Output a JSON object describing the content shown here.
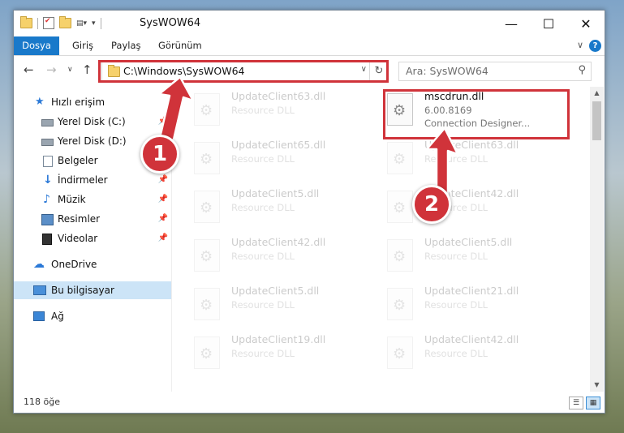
{
  "window": {
    "title": "SysWOW64"
  },
  "ribbon": {
    "tabs": [
      "Dosya",
      "Giriş",
      "Paylaş",
      "Görünüm"
    ]
  },
  "address": {
    "path": "C:\\Windows\\SysWOW64"
  },
  "search": {
    "placeholder": "Ara: SysWOW64"
  },
  "sidebar": {
    "items": [
      {
        "label": "Hızlı erişim",
        "icon": "star-icon"
      },
      {
        "label": "Yerel Disk (C:)",
        "icon": "drive-icon"
      },
      {
        "label": "Yerel Disk (D:)",
        "icon": "drive-icon"
      },
      {
        "label": "Belgeler",
        "icon": "documents-icon"
      },
      {
        "label": "İndirmeler",
        "icon": "download-icon"
      },
      {
        "label": "Müzik",
        "icon": "music-icon"
      },
      {
        "label": "Resimler",
        "icon": "pictures-icon"
      },
      {
        "label": "Videolar",
        "icon": "videos-icon"
      },
      {
        "label": "OneDrive",
        "icon": "cloud-icon"
      },
      {
        "label": "Bu bilgisayar",
        "icon": "computer-icon"
      },
      {
        "label": "Ağ",
        "icon": "network-icon"
      }
    ]
  },
  "highlighted_file": {
    "name": "mscdrun.dll",
    "version": "6.00.8169",
    "description": "Connection Designer..."
  },
  "files": [
    {
      "name": "UpdateClient63.dll",
      "desc": "Resource DLL"
    },
    {
      "name": "UpdateClient65.dll",
      "desc": "Resource DLL"
    },
    {
      "name": "UpdateClient63.dll",
      "desc": "Resource DLL"
    },
    {
      "name": "UpdateClient5.dll",
      "desc": "Resource DLL"
    },
    {
      "name": "UpdateClient42.dll",
      "desc": "Resource DLL"
    },
    {
      "name": "UpdateClient42.dll",
      "desc": "Resource DLL"
    },
    {
      "name": "UpdateClient5.dll",
      "desc": "Resource DLL"
    },
    {
      "name": "UpdateClient5.dll",
      "desc": "Resource DLL"
    },
    {
      "name": "UpdateClient21.dll",
      "desc": "Resource DLL"
    },
    {
      "name": "UpdateClient19.dll",
      "desc": "Resource DLL"
    },
    {
      "name": "UpdateClient42.dll",
      "desc": "Resource DLL"
    }
  ],
  "status": {
    "count": "118 öğe"
  },
  "annotations": {
    "step1": "1",
    "step2": "2",
    "color": "#d0333a"
  }
}
